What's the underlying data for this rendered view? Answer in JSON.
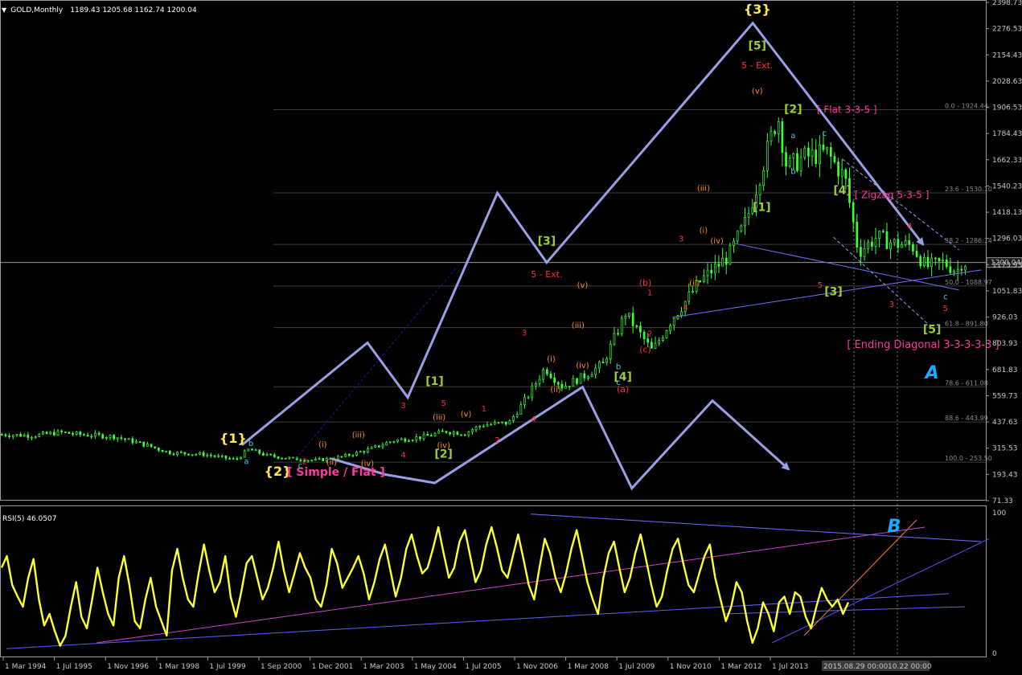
{
  "header": {
    "symbol_label": "GOLD,Monthly",
    "ohlc": "1189.43 1205.68 1162.74 1200.04"
  },
  "rsi_header": "RSI(5) 46.0507",
  "chart_data": [
    {
      "type": "candlestick",
      "title": "GOLD,Monthly",
      "x_ticks": [
        "1 Mar 1994",
        "1 Jul 1995",
        "1 Nov 1996",
        "1 Mar 1998",
        "1 Jul 1999",
        "1 Sep 2000",
        "1 Dec 2001",
        "1 Mar 2003",
        "1 May 2004",
        "1 Jul 2005",
        "1 Nov 2006",
        "1 Mar 2008",
        "1 Jul 2009",
        "1 Nov 2010",
        "1 Mar 2012",
        "1 Jul 2013"
      ],
      "y_ticks": [
        "2398.73",
        "2276.53",
        "2154.43",
        "2028.63",
        "1906.53",
        "1784.43",
        "1662.33",
        "1540.23",
        "1418.13",
        "1296.03",
        "1173.93",
        "1051.83",
        "926.03",
        "803.93",
        "681.83",
        "559.73",
        "437.63",
        "315.53",
        "193.43",
        "71.33"
      ],
      "ylim": [
        71.33,
        2398.73
      ],
      "current_price": "1200.04",
      "date_labels": [
        "2015.08.29 00:00",
        "10.22 00:00"
      ],
      "fib_levels": [
        {
          "label": "0.0 - 1924.44",
          "value": 1924.44
        },
        {
          "label": "23.6 - 1530.10",
          "value": 1530.1
        },
        {
          "label": "38.2 - 1286.14",
          "value": 1286.14
        },
        {
          "label": "50.0 - 1088.97",
          "value": 1088.97
        },
        {
          "label": "61.8 - 891.80",
          "value": 891.8
        },
        {
          "label": "78.6 - 611.08",
          "value": 611.08
        },
        {
          "label": "88.6 - 443.99",
          "value": 443.99
        },
        {
          "label": "100.0 - 253.50",
          "value": 253.5
        }
      ],
      "price_path": [
        [
          1994.2,
          385
        ],
        [
          1995.0,
          380
        ],
        [
          1995.6,
          395
        ],
        [
          1996.0,
          385
        ],
        [
          1996.8,
          375
        ],
        [
          1997.5,
          335
        ],
        [
          1998.0,
          300
        ],
        [
          1998.8,
          290
        ],
        [
          1999.5,
          265
        ],
        [
          1999.8,
          315
        ],
        [
          2000.2,
          285
        ],
        [
          2000.8,
          270
        ],
        [
          2001.3,
          262
        ],
        [
          2001.9,
          280
        ],
        [
          2002.5,
          315
        ],
        [
          2003.0,
          355
        ],
        [
          2003.7,
          375
        ],
        [
          2004.2,
          400
        ],
        [
          2004.6,
          390
        ],
        [
          2005.0,
          430
        ],
        [
          2005.6,
          440
        ],
        [
          2006.0,
          560
        ],
        [
          2006.4,
          700
        ],
        [
          2006.8,
          610
        ],
        [
          2007.3,
          665
        ],
        [
          2007.7,
          720
        ],
        [
          2008.2,
          960
        ],
        [
          2008.8,
          780
        ],
        [
          2009.2,
          920
        ],
        [
          2009.9,
          1120
        ],
        [
          2010.5,
          1230
        ],
        [
          2010.9,
          1400
        ],
        [
          2011.6,
          1900
        ],
        [
          2011.8,
          1650
        ],
        [
          2012.2,
          1700
        ],
        [
          2012.7,
          1720
        ],
        [
          2013.1,
          1600
        ],
        [
          2013.4,
          1250
        ],
        [
          2013.8,
          1320
        ],
        [
          2014.2,
          1290
        ],
        [
          2014.6,
          1280
        ],
        [
          2014.9,
          1180
        ],
        [
          2015.3,
          1200
        ],
        [
          2015.6,
          1160
        ],
        [
          2015.7,
          1200
        ]
      ],
      "wave_labels": [
        {
          "text": "{1}",
          "t": 1999.4,
          "p": 345,
          "color": "#ffe84d",
          "size": 16
        },
        {
          "text": "{2}",
          "t": 2000.4,
          "p": 190,
          "color": "#ffe84d",
          "size": 16
        },
        {
          "text": "[ Simple / Flat ]",
          "t": 2001.7,
          "p": 190,
          "color": "#ff3a9a",
          "size": 14
        },
        {
          "text": "{3}",
          "t": 2011.1,
          "p": 2380,
          "color": "#ffe84d",
          "size": 16
        },
        {
          "text": "[5]",
          "t": 2011.1,
          "p": 2210,
          "color": "#9acd32",
          "size": 14
        },
        {
          "text": "5 - Ext.",
          "t": 2011.1,
          "p": 2120,
          "color": "#ff3030",
          "size": 11
        },
        {
          "text": "[2]",
          "t": 2011.9,
          "p": 1910,
          "color": "#9acd32",
          "size": 14
        },
        {
          "text": "[ Flat 3-3-5 ]",
          "t": 2013.1,
          "p": 1910,
          "color": "#ff3a9a",
          "size": 12
        },
        {
          "text": "[4]",
          "t": 2013.0,
          "p": 1525,
          "color": "#9acd32",
          "size": 14
        },
        {
          "text": "[ Zigzag 5-3-5 ]",
          "t": 2014.1,
          "p": 1505,
          "color": "#ff3a9a",
          "size": 12
        },
        {
          "text": "[1]",
          "t": 2011.2,
          "p": 1445,
          "color": "#9acd32",
          "size": 14
        },
        {
          "text": "[3]",
          "t": 2012.8,
          "p": 1045,
          "color": "#9acd32",
          "size": 14
        },
        {
          "text": "[5]",
          "t": 2015.0,
          "p": 865,
          "color": "#9acd32",
          "size": 14
        },
        {
          "text": "[ Ending Diagonal 3-3-3-3-3 ]",
          "t": 2014.8,
          "p": 795,
          "color": "#ff3a9a",
          "size": 13
        },
        {
          "text": "A",
          "t": 2015.0,
          "p": 650,
          "color": "#1ea8ff",
          "size": 22
        },
        {
          "text": "[3]",
          "t": 2006.4,
          "p": 1285,
          "color": "#9acd32",
          "size": 14
        },
        {
          "text": "5 - Ext.",
          "t": 2006.4,
          "p": 1130,
          "color": "#ff3030",
          "size": 11
        },
        {
          "text": "[4]",
          "t": 2008.1,
          "p": 640,
          "color": "#9acd32",
          "size": 14
        },
        {
          "text": "[1]",
          "t": 2003.9,
          "p": 620,
          "color": "#9acd32",
          "size": 14
        },
        {
          "text": "[2]",
          "t": 2004.1,
          "p": 275,
          "color": "#9acd32",
          "size": 14
        },
        {
          "text": "(a)",
          "t": 2008.1,
          "p": 585,
          "color": "#ff3030",
          "size": 11
        },
        {
          "text": "(b)",
          "t": 2008.6,
          "p": 1090,
          "color": "#ff3030",
          "size": 11
        },
        {
          "text": "(c)",
          "t": 2008.6,
          "p": 775,
          "color": "#ff3030",
          "size": 11
        },
        {
          "text": "1",
          "t": 2008.7,
          "p": 1045,
          "color": "#ff3030",
          "size": 10
        },
        {
          "text": "2",
          "t": 2008.7,
          "p": 850,
          "color": "#ff3030",
          "size": 10
        },
        {
          "text": "3",
          "t": 2009.4,
          "p": 1300,
          "color": "#ff3030",
          "size": 10
        },
        {
          "text": "4",
          "t": 2009.5,
          "p": 975,
          "color": "#ff3030",
          "size": 10
        },
        {
          "text": "3",
          "t": 2005.9,
          "p": 855,
          "color": "#ff3030",
          "size": 10
        },
        {
          "text": "4",
          "t": 2006.1,
          "p": 445,
          "color": "#ff3030",
          "size": 10
        },
        {
          "text": "1",
          "t": 2005.0,
          "p": 495,
          "color": "#ff3030",
          "size": 10
        },
        {
          "text": "2",
          "t": 2005.3,
          "p": 345,
          "color": "#ff3030",
          "size": 10
        },
        {
          "text": "3",
          "t": 2003.2,
          "p": 510,
          "color": "#ff3030",
          "size": 10
        },
        {
          "text": "5",
          "t": 2004.1,
          "p": 520,
          "color": "#ff3030",
          "size": 10
        },
        {
          "text": "4",
          "t": 2003.2,
          "p": 275,
          "color": "#ff3030",
          "size": 10
        },
        {
          "text": "2",
          "t": 2001.0,
          "p": 245,
          "color": "#ff3030",
          "size": 10
        },
        {
          "text": "5",
          "t": 2012.5,
          "p": 1080,
          "color": "#ff3030",
          "size": 10
        },
        {
          "text": "4",
          "t": 2014.5,
          "p": 1360,
          "color": "#ff3030",
          "size": 10
        },
        {
          "text": "3",
          "t": 2014.1,
          "p": 990,
          "color": "#ff3030",
          "size": 10
        },
        {
          "text": "5",
          "t": 2015.3,
          "p": 970,
          "color": "#ff3030",
          "size": 10
        },
        {
          "text": "b",
          "t": 1999.8,
          "p": 330,
          "color": "#48c8e8",
          "size": 10
        },
        {
          "text": "a",
          "t": 1999.7,
          "p": 245,
          "color": "#48c8e8",
          "size": 10
        },
        {
          "text": "c",
          "t": 2000.9,
          "p": 225,
          "color": "#48c8e8",
          "size": 10
        },
        {
          "text": "b",
          "t": 2008.0,
          "p": 695,
          "color": "#48c8e8",
          "size": 10
        },
        {
          "text": "c",
          "t": 2008.0,
          "p": 620,
          "color": "#48c8e8",
          "size": 10
        },
        {
          "text": "c",
          "t": 2012.6,
          "p": 1800,
          "color": "#48c8e8",
          "size": 10
        },
        {
          "text": "a",
          "t": 2011.9,
          "p": 1790,
          "color": "#48c8e8",
          "size": 10
        },
        {
          "text": "b",
          "t": 2011.9,
          "p": 1620,
          "color": "#48c8e8",
          "size": 10
        },
        {
          "text": "c",
          "t": 2015.3,
          "p": 1025,
          "color": "#48c8e8",
          "size": 10
        },
        {
          "text": "(v)",
          "t": 2011.1,
          "p": 2000,
          "color": "#ff8c1a",
          "size": 10
        },
        {
          "text": "(iii)",
          "t": 2009.9,
          "p": 1540,
          "color": "#ff8c1a",
          "size": 10
        },
        {
          "text": "(iv)",
          "t": 2010.2,
          "p": 1290,
          "color": "#ff8c1a",
          "size": 10
        },
        {
          "text": "(i)",
          "t": 2009.9,
          "p": 1340,
          "color": "#ff8c1a",
          "size": 10
        },
        {
          "text": "(ii)",
          "t": 2009.7,
          "p": 1090,
          "color": "#ff8c1a",
          "size": 10
        },
        {
          "text": "(v)",
          "t": 2007.2,
          "p": 1080,
          "color": "#ff8c1a",
          "size": 10
        },
        {
          "text": "(iii)",
          "t": 2007.1,
          "p": 890,
          "color": "#ff8c1a",
          "size": 10
        },
        {
          "text": "(iv)",
          "t": 2007.2,
          "p": 700,
          "color": "#ff8c1a",
          "size": 10
        },
        {
          "text": "(i)",
          "t": 2006.5,
          "p": 730,
          "color": "#ff8c1a",
          "size": 10
        },
        {
          "text": "(ii)",
          "t": 2006.6,
          "p": 585,
          "color": "#ff8c1a",
          "size": 10
        },
        {
          "text": "(iii)",
          "t": 2004.0,
          "p": 455,
          "color": "#ff8c1a",
          "size": 10
        },
        {
          "text": "(v)",
          "t": 2004.6,
          "p": 470,
          "color": "#ff8c1a",
          "size": 10
        },
        {
          "text": "(iv)",
          "t": 2004.1,
          "p": 320,
          "color": "#ff8c1a",
          "size": 10
        },
        {
          "text": "(i)",
          "t": 2001.4,
          "p": 325,
          "color": "#ff8c1a",
          "size": 10
        },
        {
          "text": "(ii)",
          "t": 2001.6,
          "p": 240,
          "color": "#ff8c1a",
          "size": 10
        },
        {
          "text": "(iii)",
          "t": 2002.2,
          "p": 370,
          "color": "#ff8c1a",
          "size": 10
        },
        {
          "text": "(iv)",
          "t": 2002.4,
          "p": 235,
          "color": "#ff8c1a",
          "size": 10
        }
      ],
      "zigzag": [
        [
          1999.6,
          335
        ],
        [
          2002.4,
          820
        ],
        [
          2003.3,
          560
        ],
        [
          2005.3,
          1530
        ],
        [
          2006.4,
          1200
        ],
        [
          2011.0,
          2335
        ],
        [
          2014.8,
          1285
        ]
      ],
      "secondary_zigzag": [
        [
          2001.6,
          270
        ],
        [
          2002.8,
          195
        ],
        [
          2003.9,
          155
        ],
        [
          2007.2,
          610
        ],
        [
          2008.3,
          130
        ],
        [
          2010.1,
          545
        ],
        [
          2011.8,
          220
        ]
      ]
    },
    {
      "type": "line",
      "title": "RSI(5) 46.0507",
      "y_ticks": [
        "100",
        "0"
      ],
      "ylim": [
        0,
        100
      ],
      "series": [
        {
          "values": [
            62,
            70,
            50,
            42,
            35,
            55,
            68,
            40,
            22,
            30,
            18,
            8,
            15,
            35,
            52,
            28,
            20,
            40,
            62,
            45,
            30,
            22,
            55,
            70,
            50,
            25,
            20,
            40,
            55,
            35,
            25,
            15,
            60,
            75,
            55,
            40,
            35,
            58,
            78,
            60,
            45,
            52,
            70,
            42,
            28,
            45,
            65,
            70,
            55,
            40,
            48,
            62,
            80,
            60,
            45,
            58,
            72,
            62,
            55,
            40,
            35,
            50,
            75,
            65,
            48,
            55,
            62,
            70,
            58,
            40,
            52,
            68,
            78,
            60,
            42,
            55,
            75,
            85,
            70,
            58,
            62,
            75,
            90,
            72,
            55,
            62,
            80,
            88,
            70,
            52,
            60,
            78,
            90,
            76,
            60,
            55,
            70,
            85,
            68,
            50,
            40,
            62,
            82,
            72,
            55,
            45,
            58,
            75,
            88,
            70,
            52,
            40,
            30,
            55,
            72,
            80,
            62,
            45,
            55,
            72,
            85,
            68,
            50,
            35,
            42,
            60,
            75,
            82,
            65,
            50,
            45,
            58,
            70,
            78,
            55,
            40,
            25,
            35,
            52,
            45,
            25,
            10,
            20,
            38,
            30,
            18,
            38,
            42,
            30,
            45,
            42,
            28,
            20,
            35,
            48,
            40,
            35,
            40,
            30,
            38
          ]
        }
      ]
    }
  ]
}
